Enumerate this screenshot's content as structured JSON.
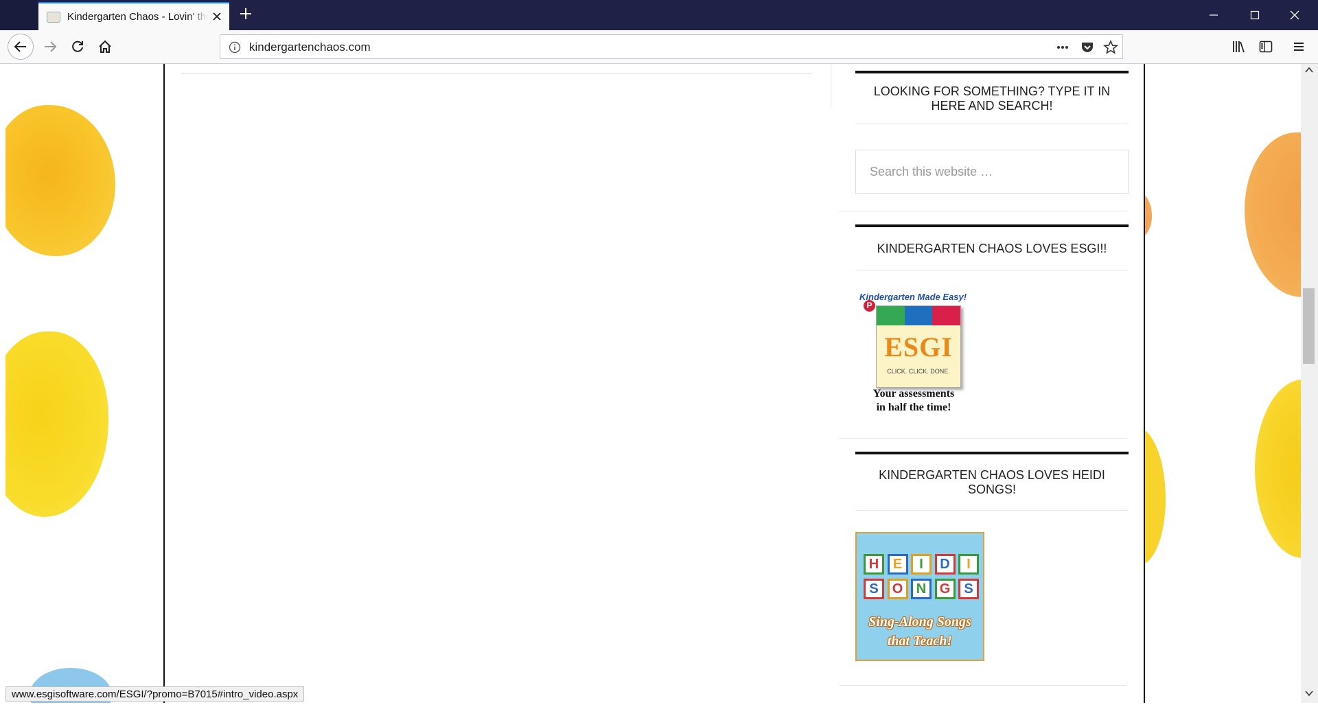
{
  "browser": {
    "tab_title": "Kindergarten Chaos - Lovin' the Chaos",
    "url": "kindergartenchaos.com",
    "status_url": "www.esgisoftware.com/ESGI/?promo=B7015#intro_video.aspx"
  },
  "sidebar": {
    "search_widget_title": "LOOKING FOR SOMETHING? TYPE IT IN HERE AND SEARCH!",
    "search_placeholder": "Search this website …",
    "esgi_widget_title": "KINDERGARTEN CHAOS LOVES ESGI!!",
    "esgi_ad": {
      "tagline": "Kindergarten Made Easy!",
      "logo_text": "ESGI",
      "logo_sub": "CLICK. CLICK. DONE.",
      "caption_line1": "Your assessments",
      "caption_line2": "in half the time!"
    },
    "heidi_widget_title": "KINDERGARTEN CHAOS LOVES HEIDI SONGS!",
    "heidi_ad": {
      "row1": [
        "H",
        "E",
        "I",
        "D",
        "I"
      ],
      "row2": [
        "S",
        "O",
        "N",
        "G",
        "S"
      ],
      "caption_line1": "Sing-Along Songs",
      "caption_line2": "that Teach!"
    }
  },
  "colors": {
    "tabbar": "#1f2147",
    "accent": "#0a84ff",
    "blob_yellow": "#f7c21e",
    "blob_orange": "#f2a24a"
  }
}
